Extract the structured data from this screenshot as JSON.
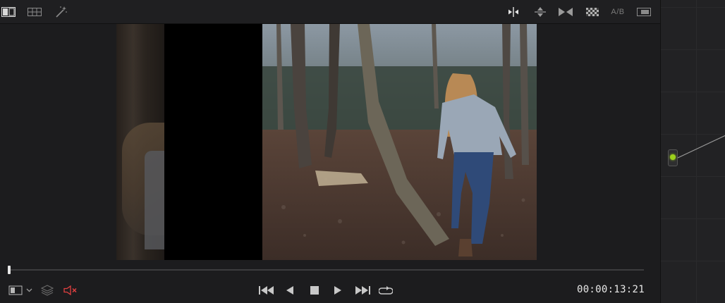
{
  "viewer": {
    "toolbar": {
      "left_icons": [
        "single-viewer-icon",
        "gallery-grid-icon",
        "magic-wand-icon"
      ],
      "right_icons": [
        "split-wipe-icon",
        "vertical-wipe-icon",
        "mirror-icon",
        "checkerboard-icon",
        "ab-compare-icon",
        "picture-in-picture-icon"
      ],
      "ab_label": "A/B"
    },
    "playhead_fraction": 0.0,
    "transport": {
      "icons": [
        "skip-to-start-icon",
        "step-back-icon",
        "stop-icon",
        "play-icon",
        "skip-to-end-icon",
        "loop-icon"
      ],
      "timecode": "00:00:13:21",
      "muted": true
    }
  },
  "colors": {
    "accent_node": "#9cd11c",
    "mute_red": "#e04040",
    "timecode": "#e8e8e8"
  }
}
